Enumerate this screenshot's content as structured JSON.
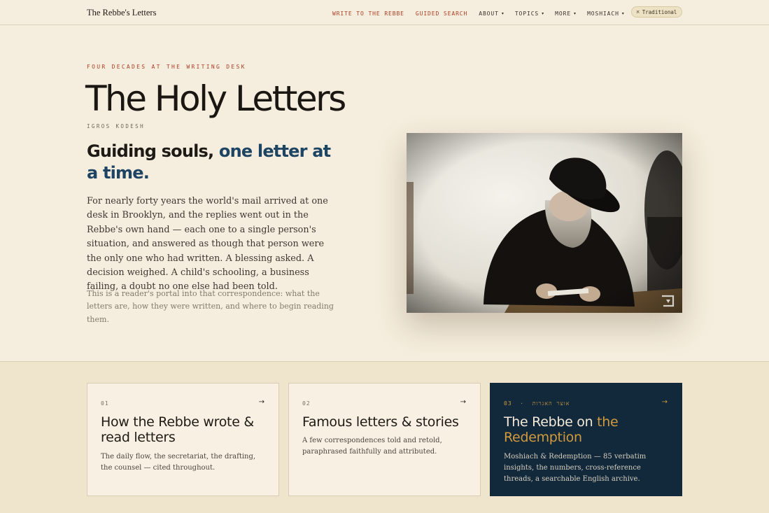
{
  "header": {
    "brand": "The Rebbe's Letters",
    "nav": [
      {
        "label": "WRITE TO THE REBBE",
        "dropdown": false,
        "style": "accent"
      },
      {
        "label": "GUIDED SEARCH",
        "dropdown": false,
        "style": "accent"
      },
      {
        "label": "ABOUT",
        "dropdown": true,
        "style": "plain"
      },
      {
        "label": "TOPICS",
        "dropdown": true,
        "style": "plain"
      },
      {
        "label": "MORE",
        "dropdown": true,
        "style": "plain"
      },
      {
        "label": "MOSHIACH",
        "dropdown": true,
        "style": "plain"
      }
    ],
    "script_toggle": {
      "icon": "hebrew-letter-icon",
      "symbol": "א",
      "label": "Traditional"
    }
  },
  "hero": {
    "eyebrow": "FOUR DECADES AT THE WRITING DESK",
    "title": "The Holy Letters",
    "subtitle": "IGROS KODESH",
    "tagline_plain": "Guiding souls, ",
    "tagline_highlight": "one letter at a time.",
    "lede": "For nearly forty years the world's mail arrived at one desk in Brooklyn, and the replies went out in the Rebbe's own hand — each one to a single person's situation, and answered as though that person were the only one who had written. A blessing asked. A decision weighed. A child's schooling, a business failing, a doubt no one else had been told.",
    "note": "This is a reader's portal into that correspondence: what the letters are, how they were written, and where to begin reading them.",
    "photo": {
      "description_icon": "rebbe-reading-letter-photo",
      "watermark_icon": "archive-watermark-icon"
    }
  },
  "cards": [
    {
      "number": "01",
      "hebrew": "",
      "title_plain": "How the Rebbe wrote & read letters",
      "title_highlight": "",
      "description": "The daily flow, the secretariat, the drafting, the counsel — cited throughout.",
      "arrow": "→"
    },
    {
      "number": "02",
      "hebrew": "",
      "title_plain": "Famous letters & stories",
      "title_highlight": "",
      "description": "A few correspondences told and retold, paraphrased faithfully and attributed.",
      "arrow": "→"
    },
    {
      "number": "03",
      "separator": "·",
      "hebrew": "אוצר האגרות",
      "title_plain": "The Rebbe on ",
      "title_highlight": "the Redemption",
      "description": "Moshiach & Redemption — 85 verbatim insights, the numbers, cross-reference threads, a searchable English archive.",
      "arrow": "→"
    }
  ],
  "colors": {
    "background": "#f5eddd",
    "accent_red": "#ad3f23",
    "tagline_blue": "#1d4463",
    "dark_card": "#12283b",
    "gold": "#d09a3e",
    "band": "#efe5cd"
  }
}
